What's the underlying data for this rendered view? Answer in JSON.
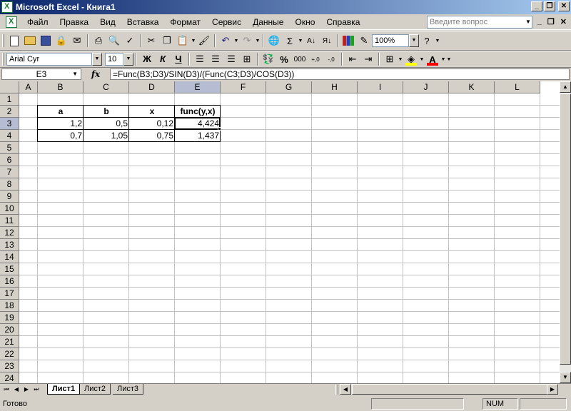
{
  "window": {
    "title": "Microsoft Excel - Книга1",
    "minimize": "_",
    "restore": "❐",
    "close": "✕"
  },
  "menu": {
    "items": [
      "Файл",
      "Правка",
      "Вид",
      "Вставка",
      "Формат",
      "Сервис",
      "Данные",
      "Окно",
      "Справка"
    ],
    "help_placeholder": "Введите вопрос",
    "doc_minimize": "_",
    "doc_restore": "❐",
    "doc_close": "✕"
  },
  "toolbar": {
    "zoom": "100%",
    "font_name": "Arial Cyr",
    "font_size": "10",
    "bold": "Ж",
    "italic": "К",
    "underline": "Ч",
    "percent": "%",
    "thousands": "000",
    "sigma": "Σ",
    "fill_color": "#ffff00",
    "font_color": "#ff0000"
  },
  "formula_bar": {
    "name_box": "E3",
    "fx": "fx",
    "formula": "=Func(B3;D3)/SIN(D3)/(Func(C3;D3)/COS(D3))"
  },
  "grid": {
    "columns": [
      "A",
      "B",
      "C",
      "D",
      "E",
      "F",
      "G",
      "H",
      "I",
      "J",
      "K",
      "L"
    ],
    "rows": [
      "1",
      "2",
      "3",
      "4",
      "5",
      "6",
      "7",
      "8",
      "9",
      "10",
      "11",
      "12",
      "13",
      "14",
      "15",
      "16",
      "17",
      "18",
      "19",
      "20",
      "21",
      "22",
      "23",
      "24"
    ],
    "selected_column": "E",
    "selected_row": "3",
    "cells": {
      "B2": "a",
      "C2": "b",
      "D2": "x",
      "E2": "func(y,x)",
      "B3": "1,2",
      "C3": "0,5",
      "D3": "0,12",
      "E3": "4,424",
      "B4": "0,7",
      "C4": "1,05",
      "D4": "0,75",
      "E4": "1,437"
    }
  },
  "sheets": {
    "tabs": [
      "Лист1",
      "Лист2",
      "Лист3"
    ],
    "active": "Лист1"
  },
  "status": {
    "text": "Готово",
    "num": "NUM"
  }
}
